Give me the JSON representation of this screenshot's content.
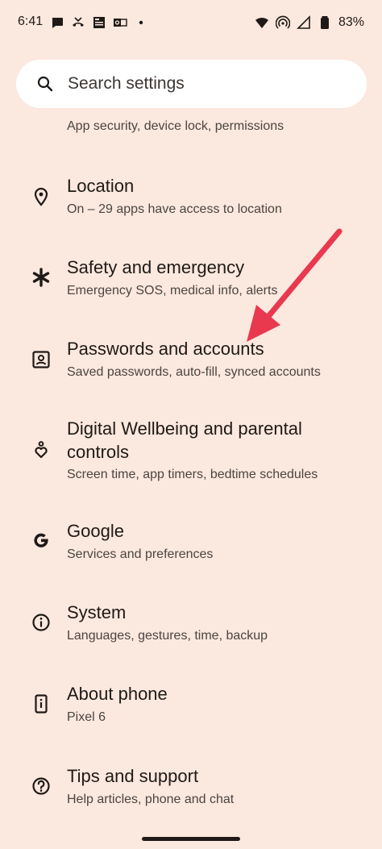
{
  "status_bar": {
    "time": "6:41",
    "battery": "83%",
    "left_icons": [
      "chat-bubble-icon",
      "missed-call-icon",
      "news-icon",
      "outlook-icon",
      "more-dots-icon"
    ],
    "right_icons": [
      "wifi-icon",
      "hotspot-icon",
      "signal-icon",
      "battery-icon"
    ]
  },
  "search": {
    "placeholder": "Search settings"
  },
  "partial_item": {
    "subtitle": "App security, device lock, permissions"
  },
  "items": [
    {
      "title": "Location",
      "subtitle": "On – 29 apps have access to location",
      "icon": "location-pin-icon"
    },
    {
      "title": "Safety and emergency",
      "subtitle": "Emergency SOS, medical info, alerts",
      "icon": "asterisk-icon"
    },
    {
      "title": "Passwords and accounts",
      "subtitle": "Saved passwords, auto-fill, synced accounts",
      "icon": "account-box-icon"
    },
    {
      "title": "Digital Wellbeing and parental controls",
      "subtitle": "Screen time, app timers, bedtime schedules",
      "icon": "wellbeing-heart-icon"
    },
    {
      "title": "Google",
      "subtitle": "Services and preferences",
      "icon": "google-g-icon"
    },
    {
      "title": "System",
      "subtitle": "Languages, gestures, time, backup",
      "icon": "info-circle-icon"
    },
    {
      "title": "About phone",
      "subtitle": "Pixel 6",
      "icon": "phone-info-icon"
    },
    {
      "title": "Tips and support",
      "subtitle": "Help articles, phone and chat",
      "icon": "help-circle-icon"
    }
  ],
  "annotation": {
    "color": "#e8394f"
  }
}
